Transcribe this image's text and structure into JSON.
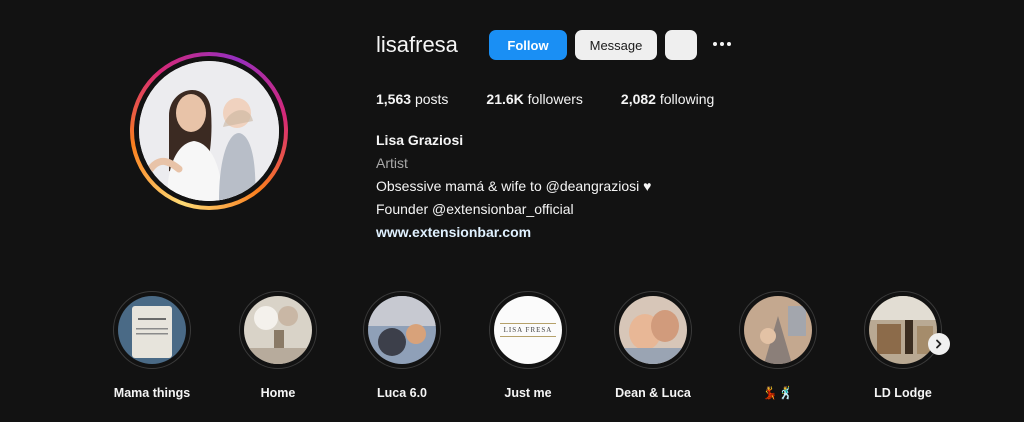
{
  "profile": {
    "username": "lisafresa",
    "follow_label": "Follow",
    "message_label": "Message"
  },
  "stats": {
    "posts": "1,563",
    "posts_label": "posts",
    "followers": "21.6K",
    "followers_label": "followers",
    "following": "2,082",
    "following_label": "following"
  },
  "bio": {
    "name": "Lisa Graziosi",
    "category": "Artist",
    "line1": "Obsessive mamá & wife to @deangraziosi ♥",
    "line2": "Founder @extensionbar_official",
    "link": "www.extensionbar.com"
  },
  "highlights": [
    {
      "label": "Mama things"
    },
    {
      "label": "Home"
    },
    {
      "label": "Luca 6.0"
    },
    {
      "label": "Just me",
      "cover_text": "LISA FRESA"
    },
    {
      "label": "Dean & Luca"
    },
    {
      "label": "💃🕺"
    },
    {
      "label": "LD Lodge"
    }
  ],
  "colors": {
    "background": "#121212",
    "follow_button": "#1a8ff4",
    "message_button": "#efefef",
    "link": "#e0f1ff"
  },
  "icons": [
    "more-options-icon",
    "suggested-users-icon",
    "chevron-right-icon"
  ]
}
